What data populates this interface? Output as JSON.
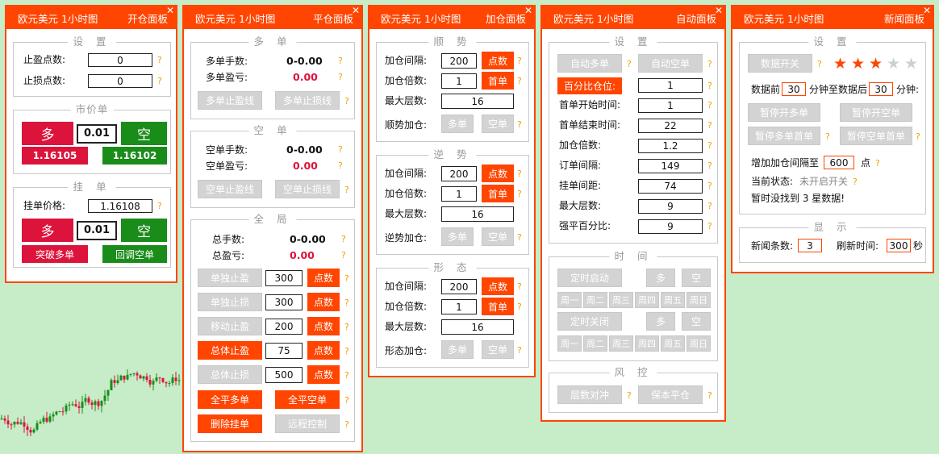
{
  "colors": {
    "accent": "#ff4500",
    "red": "#dc143c",
    "green": "#1a8c1a",
    "disabled": "#d3d3d3",
    "hint": "#f0a000"
  },
  "p1": {
    "title": "欧元美元 1小时图",
    "name": "开仓面板",
    "s1": "设 置",
    "tp_label": "止盈点数:",
    "tp_val": "0",
    "sl_label": "止损点数:",
    "sl_val": "0",
    "s2": "市价单",
    "buy": "多",
    "lot": "0.01",
    "sell": "空",
    "bid": "1.16105",
    "ask": "1.16102",
    "s3": "挂 单",
    "pend_label": "挂单价格:",
    "pend_val": "1.16108",
    "buy2": "多",
    "lot2": "0.01",
    "sell2": "空",
    "break_buy": "突破多单",
    "pull_sell": "回调空单"
  },
  "p2": {
    "title": "欧元美元 1小时图",
    "name": "平仓面板",
    "s1": "多 单",
    "long_lots_l": "多单手数:",
    "long_lots": "0-0.00",
    "long_pl_l": "多单盈亏:",
    "long_pl": "0.00",
    "long_tp": "多单止盈线",
    "long_sl": "多单止损线",
    "s2": "空 单",
    "short_lots_l": "空单手数:",
    "short_lots": "0-0.00",
    "short_pl_l": "空单盈亏:",
    "short_pl": "0.00",
    "short_tp": "空单止盈线",
    "short_sl": "空单止损线",
    "s3": "全 局",
    "tot_lots_l": "总手数:",
    "tot_lots": "0-0.00",
    "tot_pl_l": "总盈亏:",
    "tot_pl": "0.00",
    "rows": [
      {
        "btn": "单独止盈",
        "val": "300",
        "unit": "点数"
      },
      {
        "btn": "单独止损",
        "val": "300",
        "unit": "点数"
      },
      {
        "btn": "移动止盈",
        "val": "200",
        "unit": "点数"
      },
      {
        "btn": "总体止盈",
        "val": "75",
        "unit": "点数"
      },
      {
        "btn": "总体止损",
        "val": "500",
        "unit": "点数"
      }
    ],
    "close_long": "全平多单",
    "close_short": "全平空单",
    "del_pend": "删除挂单",
    "remote": "远程控制"
  },
  "p3": {
    "title": "欧元美元 1小时图",
    "name": "加仓面板",
    "groups": [
      {
        "title": "顺 势",
        "int_l": "加仓间隔:",
        "int": "200",
        "unit": "点数",
        "mul_l": "加仓倍数:",
        "mul": "1",
        "first": "首单",
        "max_l": "最大层数:",
        "max": "16",
        "add_l": "顺势加仓:",
        "b1": "多单",
        "b2": "空单"
      },
      {
        "title": "逆 势",
        "int_l": "加仓间隔:",
        "int": "200",
        "unit": "点数",
        "mul_l": "加仓倍数:",
        "mul": "1",
        "first": "首单",
        "max_l": "最大层数:",
        "max": "16",
        "add_l": "逆势加仓:",
        "b1": "多单",
        "b2": "空单"
      },
      {
        "title": "形 态",
        "int_l": "加仓间隔:",
        "int": "200",
        "unit": "点数",
        "mul_l": "加仓倍数:",
        "mul": "1",
        "first": "首单",
        "max_l": "最大层数:",
        "max": "16",
        "add_l": "形态加仓:",
        "b1": "多单",
        "b2": "空单"
      }
    ]
  },
  "p4": {
    "title": "欧元美元 1小时图",
    "name": "自动面板",
    "s1": "设 置",
    "auto_long": "自动多单",
    "auto_short": "自动空单",
    "pct_pos": "百分比仓位:",
    "pct_val": "1",
    "fields": [
      {
        "l": "首单开始时间:",
        "v": "1"
      },
      {
        "l": "首单结束时间:",
        "v": "22"
      },
      {
        "l": "加仓倍数:",
        "v": "1.2"
      },
      {
        "l": "订单间隔:",
        "v": "149"
      },
      {
        "l": "挂单间距:",
        "v": "74"
      },
      {
        "l": "最大层数:",
        "v": "9"
      },
      {
        "l": "强平百分比:",
        "v": "9"
      }
    ],
    "s2": "时 间",
    "timer_on": "定时启动",
    "timer_off": "定时关闭",
    "long": "多",
    "short": "空",
    "days": [
      "周一",
      "周二",
      "周三",
      "周四",
      "周五",
      "周日"
    ],
    "s3": "风 控",
    "layer_hedge": "层数对冲",
    "protect_close": "保本平仓"
  },
  "p5": {
    "title": "欧元美元 1小时图",
    "name": "新闻面板",
    "s1": "设 置",
    "data_switch": "数据开关",
    "stars_filled": 3,
    "stars_total": 5,
    "before_l": "数据前",
    "before": "30",
    "mid_l": "分钟至数据后",
    "after": "30",
    "after_l": "分钟:",
    "pause_long": "暂停开多单",
    "pause_short": "暂停开空单",
    "pause_long_first": "暂停多单首单",
    "pause_short_first": "暂停空单首单",
    "inc_l": "增加加仓间隔至",
    "inc": "600",
    "inc_unit": "点",
    "status_l": "当前状态:",
    "status": "未开启开关",
    "notfound": "暂时没找到 3 星数据!",
    "s2": "显 示",
    "news_count_l": "新闻条数:",
    "news_count": "3",
    "refresh_l": "刷新时间:",
    "refresh": "300",
    "refresh_unit": "秒"
  },
  "q": "?"
}
